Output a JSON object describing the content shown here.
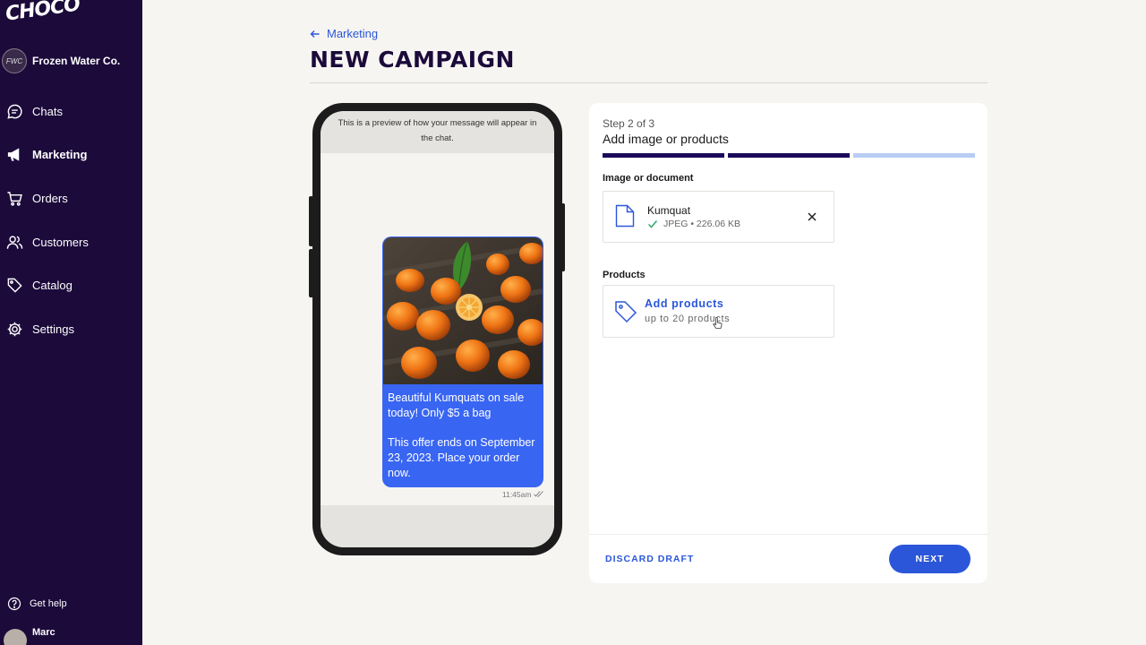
{
  "sidebar": {
    "logo": "CHOCO",
    "org": {
      "initials": "FWC",
      "name": "Frozen Water Co."
    },
    "items": [
      {
        "label": "Chats",
        "icon": "chat-icon"
      },
      {
        "label": "Marketing",
        "icon": "megaphone-icon",
        "active": true
      },
      {
        "label": "Orders",
        "icon": "cart-icon"
      },
      {
        "label": "Customers",
        "icon": "people-icon"
      },
      {
        "label": "Catalog",
        "icon": "tag-icon"
      },
      {
        "label": "Settings",
        "icon": "gear-icon"
      }
    ],
    "help": "Get help",
    "user": "Marc"
  },
  "header": {
    "breadcrumb": "Marketing",
    "title": "NEW CAMPAIGN"
  },
  "preview": {
    "note": "This is a preview of how your message will appear in the chat.",
    "message": "Beautiful Kumquats on sale today! Only $5 a bag\n\nThis offer ends on September 23, 2023. Place your order now.",
    "time": "11:45am"
  },
  "card": {
    "step": "Step 2 of 3",
    "step_title": "Add image or products",
    "progress": {
      "current": 2,
      "total": 3
    },
    "image_section": {
      "label": "Image or document",
      "file_name": "Kumquat",
      "file_meta": "JPEG • 226.06 KB"
    },
    "products_section": {
      "label": "Products",
      "add_label": "Add products",
      "add_sub": "up to 20 products"
    },
    "footer": {
      "discard": "DISCARD DRAFT",
      "next": "NEXT"
    }
  },
  "colors": {
    "sidebar_bg": "#1b0a3a",
    "accent": "#2b56d9",
    "bubble": "#3865f2",
    "progress_done": "#1b0a5a",
    "progress_todo": "#b9cdf3",
    "success": "#2ea86b"
  }
}
